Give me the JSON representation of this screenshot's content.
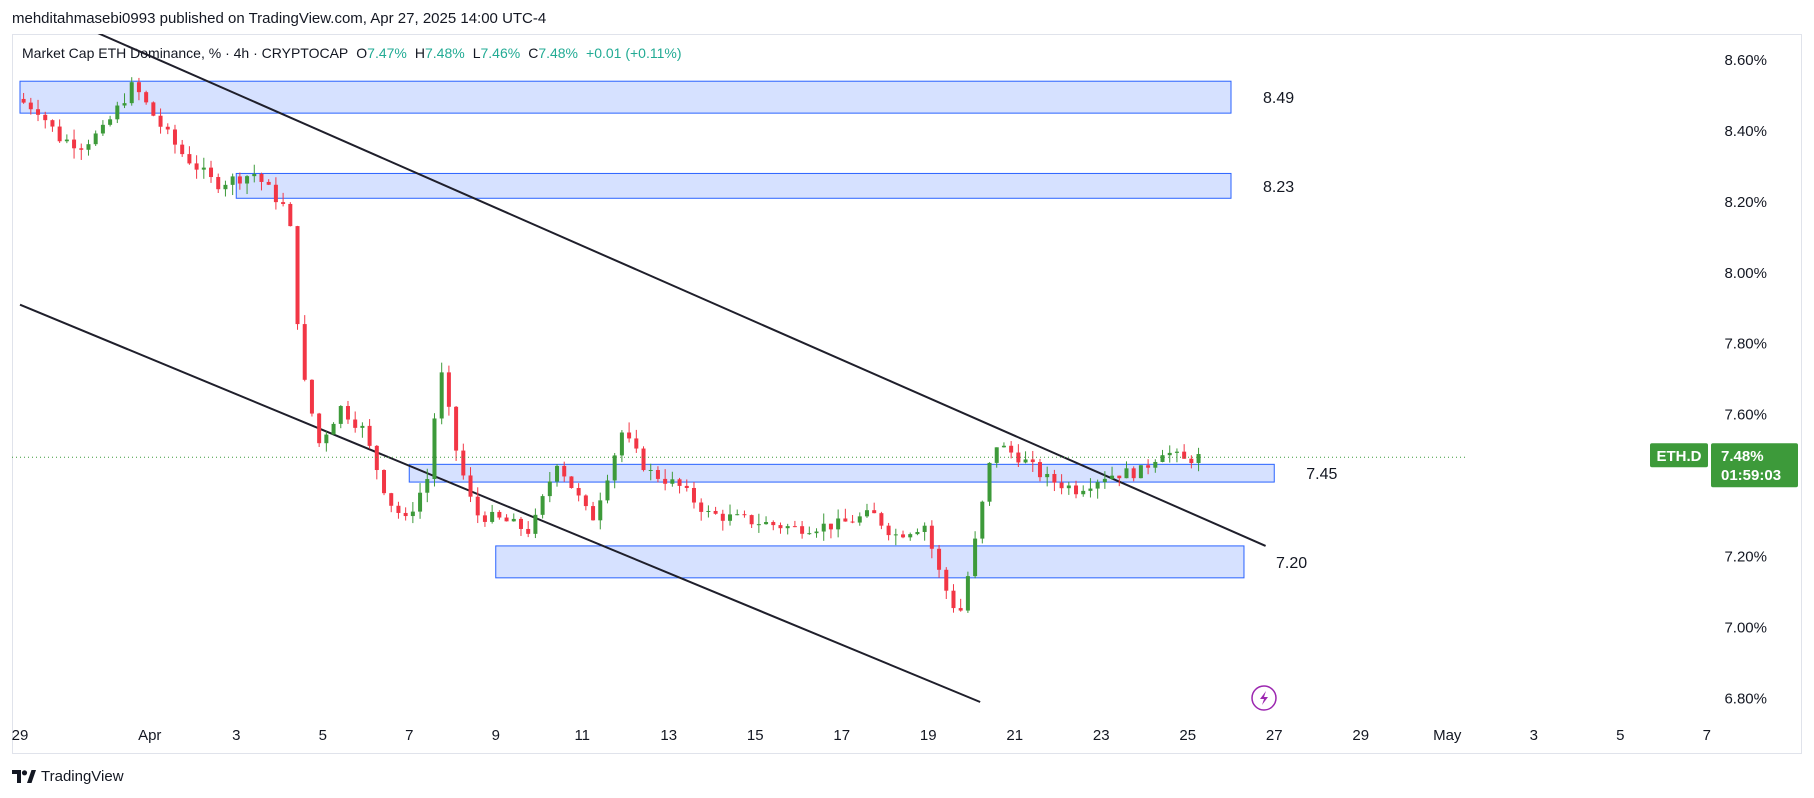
{
  "header": {
    "publisher_line": "mehditahmasebi0993 published on TradingView.com, Apr 27, 2025 14:00 UTC-4"
  },
  "legend": {
    "title": "Market Cap ETH Dominance, % · 4h · CRYPTOCAP",
    "open_label": "O",
    "open": "7.47%",
    "high_label": "H",
    "high": "7.48%",
    "low_label": "L",
    "low": "7.46%",
    "close_label": "C",
    "close": "7.48%",
    "change": "+0.01 (+0.11%)"
  },
  "footer": {
    "brand": "TradingView",
    "logo_icon": "tradingview-logo-icon"
  },
  "colors": {
    "up": "#26a69a",
    "up_candle": "#3d9a3a",
    "down": "#f23645",
    "zone_fill": "#cfdcff",
    "zone_border": "#2962ff",
    "trendline": "#1f1f2b",
    "badge": "#3d9a3a",
    "accent_purple": "#9c27b0"
  },
  "price_badge": {
    "symbol": "ETH.D",
    "price": "7.48%",
    "countdown": "01:59:03"
  },
  "chart_data": {
    "type": "candlestick",
    "title": "Market Cap ETH Dominance, %",
    "interval": "4h",
    "x_axis": {
      "unit": "date",
      "range": [
        "2025-03-29",
        "2025-05-08"
      ],
      "ticks": [
        {
          "date": "2025-03-29",
          "label": "29"
        },
        {
          "date": "2025-04-01",
          "label": "Apr"
        },
        {
          "date": "2025-04-03",
          "label": "3"
        },
        {
          "date": "2025-04-05",
          "label": "5"
        },
        {
          "date": "2025-04-07",
          "label": "7"
        },
        {
          "date": "2025-04-09",
          "label": "9"
        },
        {
          "date": "2025-04-11",
          "label": "11"
        },
        {
          "date": "2025-04-13",
          "label": "13"
        },
        {
          "date": "2025-04-15",
          "label": "15"
        },
        {
          "date": "2025-04-17",
          "label": "17"
        },
        {
          "date": "2025-04-19",
          "label": "19"
        },
        {
          "date": "2025-04-21",
          "label": "21"
        },
        {
          "date": "2025-04-23",
          "label": "23"
        },
        {
          "date": "2025-04-25",
          "label": "25"
        },
        {
          "date": "2025-04-27",
          "label": "27"
        },
        {
          "date": "2025-04-29",
          "label": "29"
        },
        {
          "date": "2025-05-01",
          "label": "May"
        },
        {
          "date": "2025-05-03",
          "label": "3"
        },
        {
          "date": "2025-05-05",
          "label": "5"
        },
        {
          "date": "2025-05-07",
          "label": "7"
        }
      ]
    },
    "y_axis": {
      "unit": "%",
      "range": [
        6.79,
        8.69
      ],
      "ticks": [
        {
          "value": 8.6,
          "label": "8.60%"
        },
        {
          "value": 8.4,
          "label": "8.40%"
        },
        {
          "value": 8.2,
          "label": "8.20%"
        },
        {
          "value": 8.0,
          "label": "8.00%"
        },
        {
          "value": 7.8,
          "label": "7.80%"
        },
        {
          "value": 7.6,
          "label": "7.60%"
        },
        {
          "value": 7.2,
          "label": "7.20%"
        },
        {
          "value": 7.0,
          "label": "7.00%"
        },
        {
          "value": 6.8,
          "label": "6.80%"
        }
      ]
    },
    "current_price": 7.48,
    "zones": [
      {
        "start": "2025-03-29",
        "end": "2025-04-26",
        "low": 8.45,
        "high": 8.54,
        "label": "8.49"
      },
      {
        "start": "2025-04-03",
        "end": "2025-04-26",
        "low": 8.21,
        "high": 8.28,
        "label": "8.23"
      },
      {
        "start": "2025-04-07",
        "end": "2025-04-27",
        "low": 7.41,
        "high": 7.46,
        "label": "7.45"
      },
      {
        "start": "2025-04-09",
        "end": "2025-04-26.3",
        "low": 7.14,
        "high": 7.23,
        "label": "7.20"
      }
    ],
    "trendlines": [
      {
        "from": {
          "date": "2025-03-29.6",
          "value": 8.74
        },
        "to": {
          "date": "2025-04-26.8",
          "value": 7.23
        }
      },
      {
        "from": {
          "date": "2025-03-29",
          "value": 7.91
        },
        "to": {
          "date": "2025-04-20.2",
          "value": 6.79
        }
      }
    ],
    "ohlc": []
  }
}
